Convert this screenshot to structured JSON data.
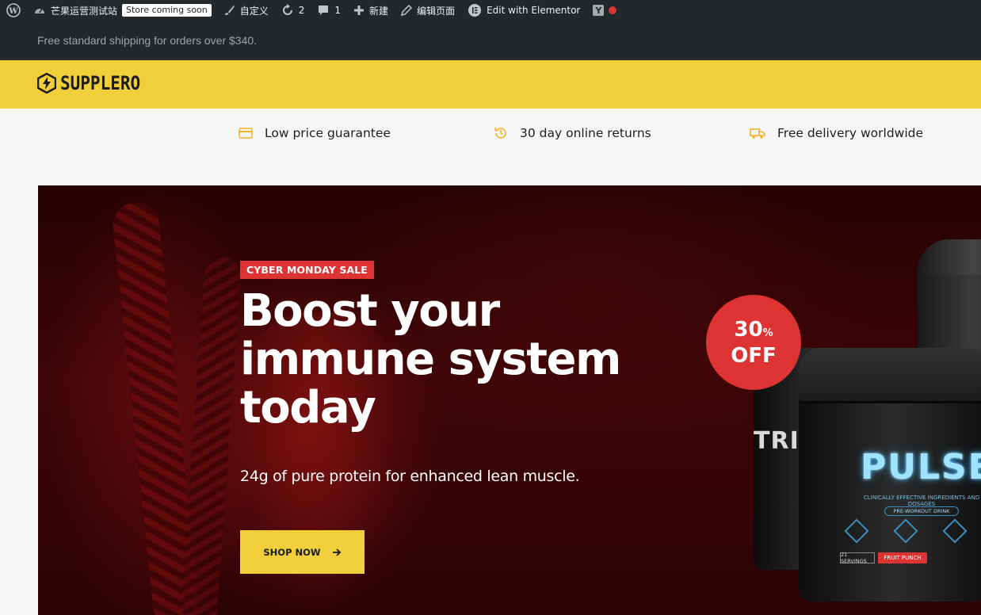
{
  "adminbar": {
    "site_name": "芒果运营测试站",
    "coming_soon": "Store coming soon",
    "customize": "自定义",
    "updates_count": "2",
    "comments_count": "1",
    "new": "新建",
    "edit_page": "编辑页面",
    "elementor": "Edit with Elementor"
  },
  "notice": {
    "text": "Free standard shipping for orders over $340."
  },
  "header": {
    "logo_text": "SUPPLERO"
  },
  "usp": [
    {
      "label": "Low price guarantee",
      "icon": "credit-card-icon"
    },
    {
      "label": "30 day online returns",
      "icon": "history-icon"
    },
    {
      "label": "Free delivery worldwide",
      "icon": "truck-icon"
    }
  ],
  "hero": {
    "badge": "CYBER MONDAY SALE",
    "title_line1": "Boost your",
    "title_line2": "immune system",
    "title_line3": "today",
    "subtitle": "24g of pure protein for enhanced lean muscle.",
    "button": "SHOP NOW",
    "discount_number": "30",
    "discount_percent": "%",
    "discount_word": "OFF"
  },
  "product": {
    "name": "PULSE",
    "left_tub_label": "TRIUM",
    "tagline": "CLINICALLY EFFECTIVE INGREDIENTS AND DOSAGES",
    "tag": "PRE-WORKOUT DRINK",
    "servings": "21 SERVINGS",
    "flavor": "FRUIT PUNCH"
  },
  "colors": {
    "accent": "#f0cf3a",
    "sale": "#dd3333",
    "admin_bg": "#23282d"
  }
}
